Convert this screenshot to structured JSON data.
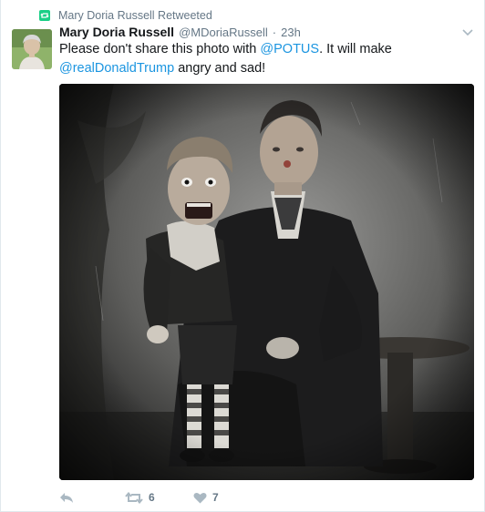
{
  "tweet": {
    "retweet_context": "Mary Doria Russell Retweeted",
    "author_name": "Mary Doria Russell",
    "author_handle": "@MDoriaRussell",
    "separator": "·",
    "timestamp": "23h",
    "text_part1": "Please don't share this photo with ",
    "mention1": "@POTUS",
    "text_part2": ". It will make ",
    "mention2": "@realDonaldTrump",
    "text_part3": " angry and sad!",
    "retweet_count": "6",
    "like_count": "7"
  },
  "icons": {
    "retweeted": "retweet-icon",
    "caret": "chevron-down-icon",
    "reply": "reply-icon",
    "retweet": "retweet-icon",
    "like": "heart-icon"
  },
  "colors": {
    "accent": "#1b95e0",
    "retweet_green": "#19cf86",
    "muted": "#657786",
    "action_gray": "#aab8c2"
  }
}
